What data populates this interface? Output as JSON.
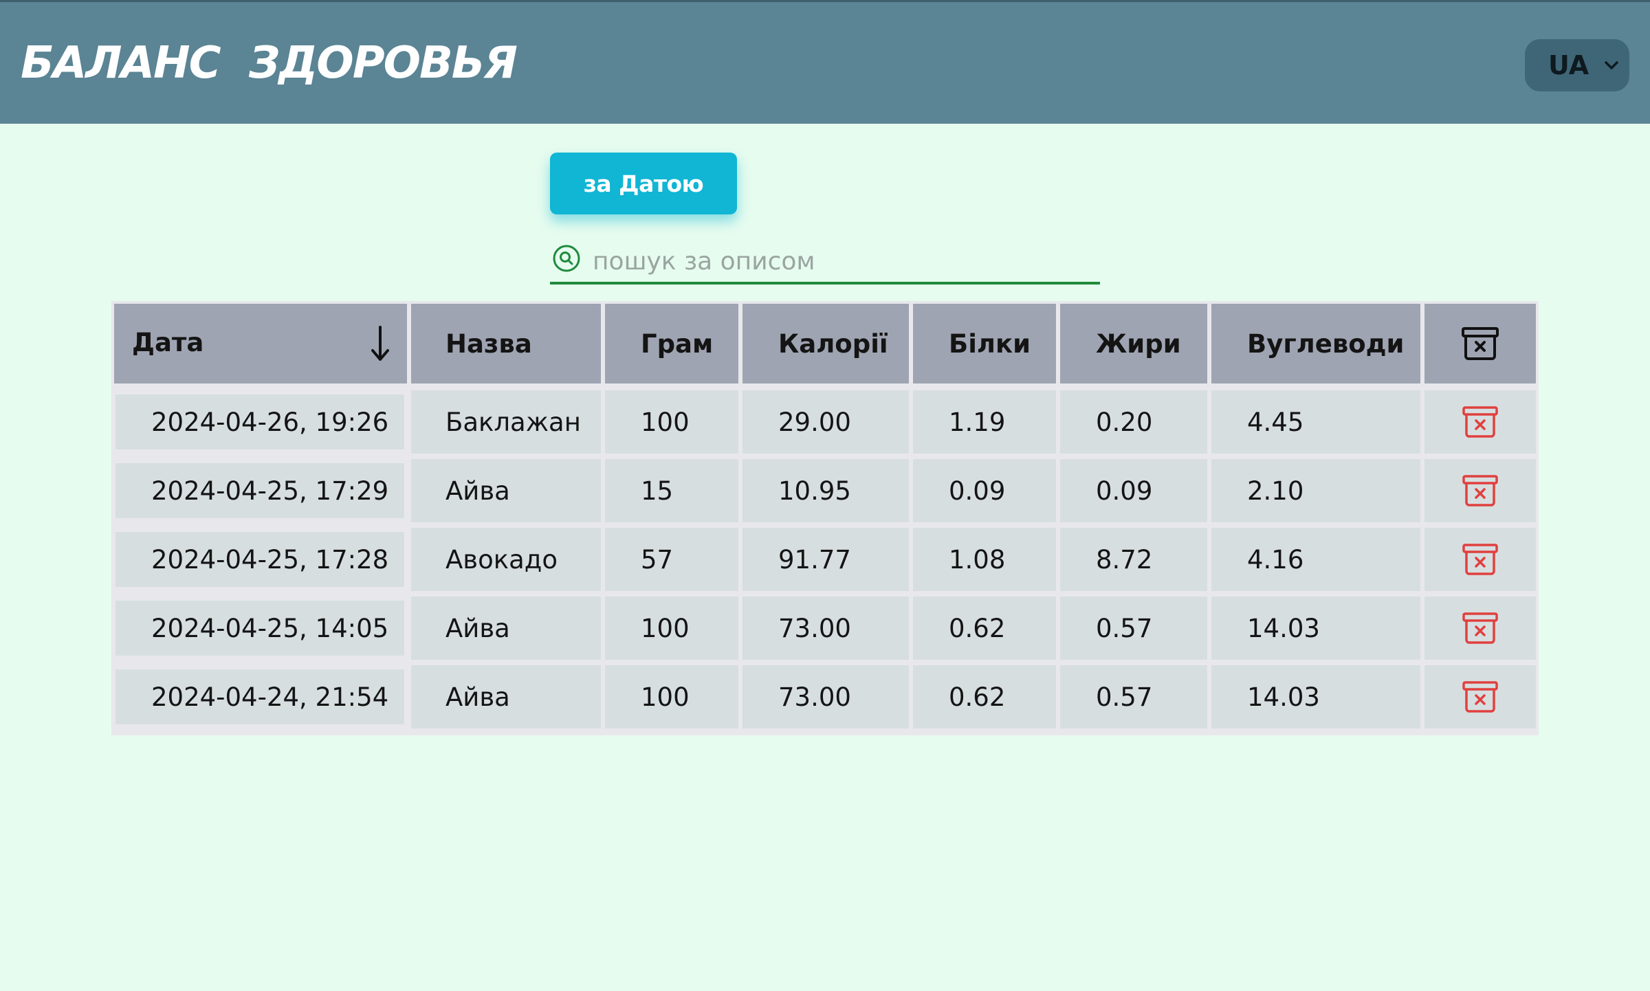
{
  "header": {
    "title": "БАЛАНС  ЗДОРОВЬЯ",
    "language": "UA"
  },
  "controls": {
    "sort_button_label": "за Датою",
    "search_placeholder": "пошук за описом",
    "search_value": ""
  },
  "table": {
    "columns": [
      "Дата",
      "Назва",
      "Грам",
      "Калорії",
      "Білки",
      "Жири",
      "Вуглеводи"
    ],
    "delete_all_icon": "archive-x-icon",
    "row_delete_icon": "delete-row-icon",
    "sort_icon": "arrow-down-icon",
    "rows": [
      [
        "2024-04-26, 19:26",
        "Баклажан",
        "100",
        "29.00",
        "1.19",
        "0.20",
        "4.45"
      ],
      [
        "2024-04-25, 17:29",
        "Айва",
        "15",
        "10.95",
        "0.09",
        "0.09",
        "2.10"
      ],
      [
        "2024-04-25, 17:28",
        "Авокадо",
        "57",
        "91.77",
        "1.08",
        "8.72",
        "4.16"
      ],
      [
        "2024-04-25, 14:05",
        "Айва",
        "100",
        "73.00",
        "0.62",
        "0.57",
        "14.03"
      ],
      [
        "2024-04-24, 21:54",
        "Айва",
        "100",
        "73.00",
        "0.62",
        "0.57",
        "14.03"
      ]
    ]
  },
  "colors": {
    "header_bg": "#5b8494",
    "page_bg": "#e6fcef",
    "accent": "#10b6d4",
    "search_line": "#1f8a3c",
    "delete_icon": "#e0403e",
    "table_header_bg": "#9fa4b2",
    "table_cell_bg": "#d7dee0"
  }
}
